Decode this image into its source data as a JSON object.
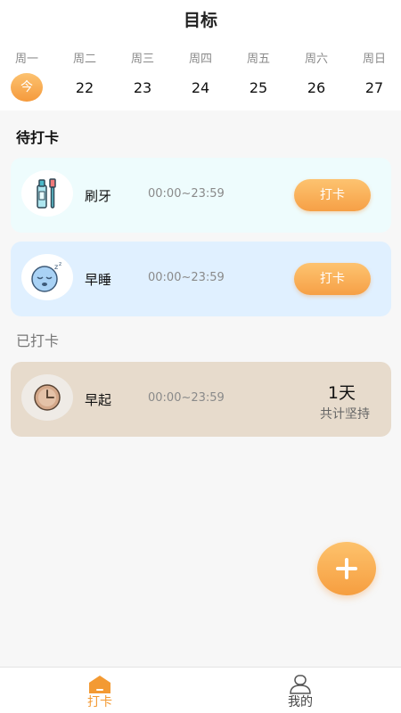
{
  "header": {
    "title": "目标"
  },
  "week": [
    {
      "name": "周一",
      "date": "今",
      "today": true
    },
    {
      "name": "周二",
      "date": "22"
    },
    {
      "name": "周三",
      "date": "23"
    },
    {
      "name": "周四",
      "date": "24"
    },
    {
      "name": "周五",
      "date": "25"
    },
    {
      "name": "周六",
      "date": "26"
    },
    {
      "name": "周日",
      "date": "27"
    }
  ],
  "pending": {
    "label": "待打卡",
    "items": [
      {
        "name": "刷牙",
        "time": "00:00~23:59",
        "button": "打卡",
        "icon": "toothbrush-icon",
        "bg": "#eefcfd"
      },
      {
        "name": "早睡",
        "time": "00:00~23:59",
        "button": "打卡",
        "icon": "sleep-face-icon",
        "bg": "#e0f0ff"
      }
    ]
  },
  "done": {
    "label": "已打卡",
    "items": [
      {
        "name": "早起",
        "time": "00:00~23:59",
        "streak": "1天",
        "streak_label": "共计坚持",
        "icon": "clock-icon",
        "bg": "#e7dbcc"
      }
    ]
  },
  "fab": {
    "icon": "plus-icon"
  },
  "tabs": [
    {
      "label": "打卡",
      "icon": "home-icon",
      "active": true
    },
    {
      "label": "我的",
      "icon": "profile-icon",
      "active": false
    }
  ],
  "colors": {
    "accent": "#f5a243",
    "active_tab": "#f39a33",
    "inactive_tab": "#444444"
  }
}
